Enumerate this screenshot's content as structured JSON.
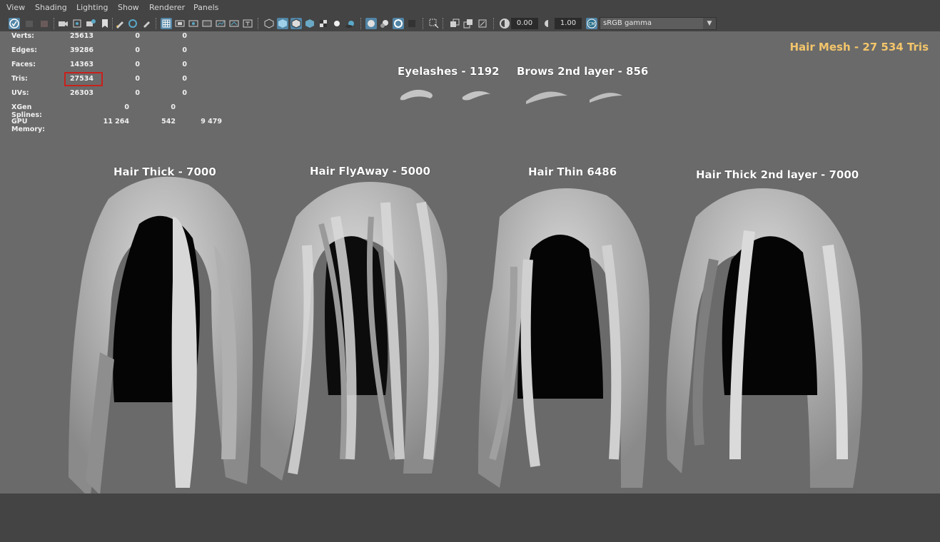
{
  "menu": [
    "View",
    "Shading",
    "Lighting",
    "Show",
    "Renderer",
    "Panels"
  ],
  "toolbar": {
    "exposure": "0.00",
    "gamma": "1.00",
    "color_space": "sRGB gamma"
  },
  "hud": {
    "rows": [
      {
        "label": "Verts:",
        "c1": "25613",
        "c2": "0",
        "c3": "0"
      },
      {
        "label": "Edges:",
        "c1": "39286",
        "c2": "0",
        "c3": "0"
      },
      {
        "label": "Faces:",
        "c1": "14363",
        "c2": "0",
        "c3": "0"
      },
      {
        "label": "Tris:",
        "c1": "27534",
        "c2": "0",
        "c3": "0"
      },
      {
        "label": "UVs:",
        "c1": "26303",
        "c2": "0",
        "c3": "0"
      }
    ],
    "xgen": {
      "label": "XGen Splines:",
      "c1": "0",
      "c2": "0"
    },
    "gpu": {
      "label": "GPU Memory:",
      "c1": "11 264",
      "c2": "542",
      "c3": "9 479"
    }
  },
  "overlay_title": "Hair Mesh - 27 534 Tris",
  "labels": {
    "eyelashes": "Eyelashes - 1192",
    "brows": "Brows 2nd layer - 856",
    "hair_thick": "Hair Thick - 7000",
    "hair_flyaway": "Hair FlyAway - 5000",
    "hair_thin": "Hair Thin 6486",
    "hair_thick2": "Hair Thick 2nd layer - 7000"
  },
  "colors": {
    "viewport_bg": "#6a6a6a",
    "ui_bg": "#444444",
    "title_accent": "#f2c56b",
    "highlight_box": "#c8211c"
  }
}
